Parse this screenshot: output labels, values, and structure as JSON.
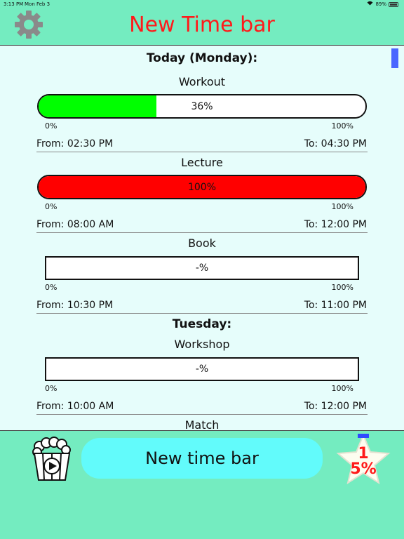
{
  "status_bar": {
    "time": "3:13 PM",
    "date": "Mon Feb 3",
    "battery": "89%"
  },
  "header": {
    "title": "New Time bar",
    "settings_icon": "gear-icon"
  },
  "days": [
    {
      "label": "Today (Monday):",
      "items": [
        {
          "name": "Workout",
          "percent_text": "36%",
          "progress": 0.36,
          "fill_color": "#00ff00",
          "scale_min": "0%",
          "scale_max": "100%",
          "from": "From: 02:30 PM",
          "to": "To: 04:30 PM"
        },
        {
          "name": "Lecture",
          "percent_text": "100%",
          "progress": 1.0,
          "fill_color": "#ff0000",
          "scale_min": "0%",
          "scale_max": "100%",
          "from": "From: 08:00 AM",
          "to": "To: 12:00 PM"
        },
        {
          "name": "Book",
          "percent_text": "-%",
          "progress": 0,
          "scale_min": "0%",
          "scale_max": "100%",
          "from": "From: 10:30 PM",
          "to": "To: 11:00 PM"
        }
      ]
    },
    {
      "label": "Tuesday:",
      "items": [
        {
          "name": "Workshop",
          "percent_text": "-%",
          "progress": 0,
          "scale_min": "0%",
          "scale_max": "100%",
          "from": "From: 10:00 AM",
          "to": "To: 12:00 PM"
        },
        {
          "name": "Match"
        }
      ]
    }
  ],
  "footer": {
    "new_button_label": "New time bar",
    "popcorn_icon": "popcorn-play-icon",
    "badge_digit": "1",
    "badge_percent": "5%",
    "badge_icon": "star-icon"
  },
  "colors": {
    "background": "#74ecc0",
    "list_background": "#e6fdfb",
    "title": "#ff1a1a",
    "button": "#62fbfb",
    "progress_on": "#00ff00",
    "progress_done": "#ff0000"
  }
}
